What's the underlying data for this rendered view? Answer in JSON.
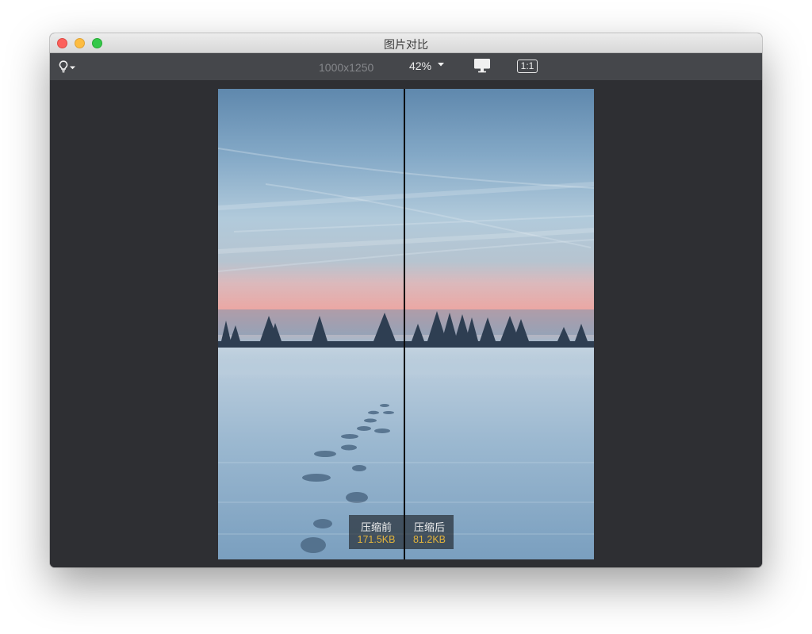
{
  "window": {
    "title": "图片对比"
  },
  "toolbar": {
    "bulb_icon": "lightbulb-icon",
    "dimensions": "1000x1250",
    "zoom": "42%",
    "monitor_icon": "monitor-icon",
    "actual_size": "1:1"
  },
  "compare": {
    "before": {
      "label": "压缩前",
      "size": "171.5KB"
    },
    "after": {
      "label": "压缩后",
      "size": "81.2KB"
    }
  },
  "colors": {
    "canvas": "#2e2f33",
    "toolbar": "#45474b",
    "size_text": "#e2b43c",
    "sky_top": "#5f88ad",
    "sunset_band": "#e9a8a3",
    "snow": "#8fb2cf"
  }
}
